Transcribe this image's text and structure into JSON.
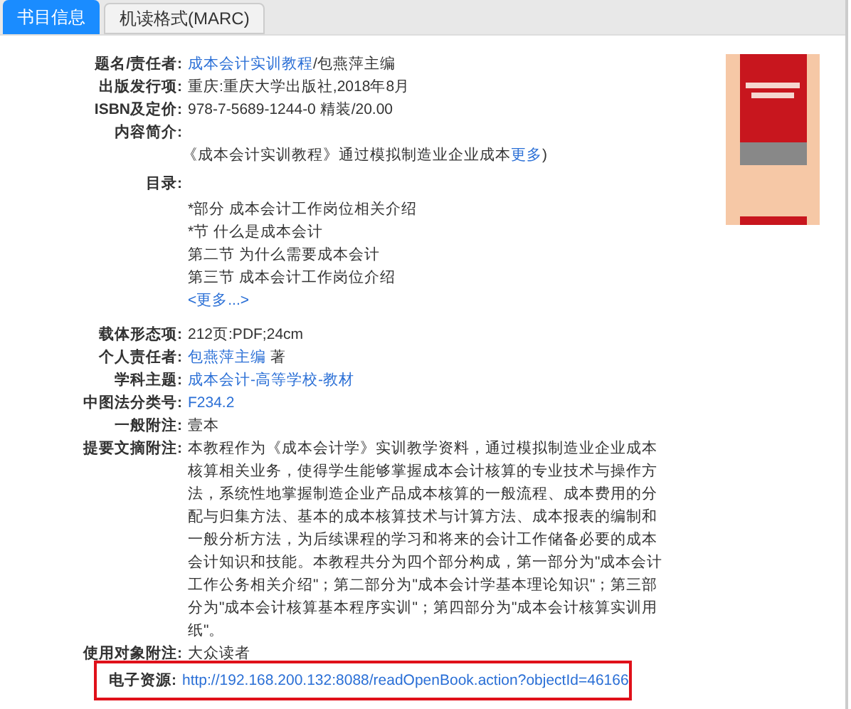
{
  "tabs": [
    {
      "label": "书目信息",
      "selected": true
    },
    {
      "label": "机读格式(MARC)",
      "selected": false
    }
  ],
  "fields": [
    {
      "kind": "inline",
      "label": "题名/责任者:",
      "parts": [
        {
          "text": "成本会计实训教程",
          "link": true
        },
        {
          "text": "/包燕萍主编",
          "link": false
        }
      ]
    },
    {
      "kind": "inline",
      "label": "出版发行项:",
      "parts": [
        {
          "text": "重庆:重庆大学出版社,2018年8月",
          "link": false
        }
      ]
    },
    {
      "kind": "inline",
      "label": "ISBN及定价:",
      "parts": [
        {
          "text": "978-7-5689-1244-0 精装/20.00",
          "link": false
        }
      ]
    },
    {
      "kind": "block",
      "label": "内容简介:",
      "parts": [
        {
          "text": "《成本会计实训教程》通过模拟制造业企业成本",
          "link": false
        },
        {
          "text": "更多",
          "link": true
        },
        {
          "text": ")",
          "link": false
        }
      ]
    },
    {
      "kind": "list",
      "label": "目录:",
      "items": [
        "*部分 成本会计工作岗位相关介绍",
        "*节 什么是成本会计",
        "第二节 为什么需要成本会计",
        "第三节 成本会计工作岗位介绍"
      ],
      "more": "<更多...>"
    },
    {
      "kind": "inline",
      "label": "载体形态项:",
      "parts": [
        {
          "text": "212页:PDF;24cm",
          "link": false
        }
      ]
    },
    {
      "kind": "inline",
      "label": "个人责任者:",
      "parts": [
        {
          "text": "包燕萍主编",
          "link": true
        },
        {
          "text": " 著",
          "link": false
        }
      ]
    },
    {
      "kind": "inline",
      "label": "学科主题:",
      "parts": [
        {
          "text": "成本会计-高等学校-教材",
          "link": true
        }
      ]
    },
    {
      "kind": "inline",
      "label": "中图法分类号:",
      "parts": [
        {
          "text": "F234.2",
          "link": true
        }
      ]
    },
    {
      "kind": "inline",
      "label": "一般附注:",
      "parts": [
        {
          "text": "壹本",
          "link": false
        }
      ]
    },
    {
      "kind": "inline",
      "label": "提要文摘附注:",
      "parts": [
        {
          "text": "本教程作为《成本会计学》实训教学资料，通过模拟制造业企业成本核算相关业务，使得学生能够掌握成本会计核算的专业技术与操作方法，系统性地掌握制造企业产品成本核算的一般流程、成本费用的分配与归集方法、基本的成本核算技术与计算方法、成本报表的编制和一般分析方法，为后续课程的学习和将来的会计工作储备必要的成本会计知识和技能。本教程共分为四个部分构成，第一部分为\"成本会计工作公务相关介绍\"；第二部分为\"成本会计学基本理论知识\"；第三部分为\"成本会计核算基本程序实训\"；第四部分为\"成本会计核算实训用纸\"。",
          "link": false
        }
      ]
    },
    {
      "kind": "inline",
      "label": "使用对象附注:",
      "parts": [
        {
          "text": "大众读者",
          "link": false
        }
      ]
    },
    {
      "kind": "highlight",
      "label": "电子资源:",
      "parts": [
        {
          "text": "http://192.168.200.132:8088/readOpenBook.action?objectId=46166",
          "link": true
        }
      ]
    }
  ]
}
